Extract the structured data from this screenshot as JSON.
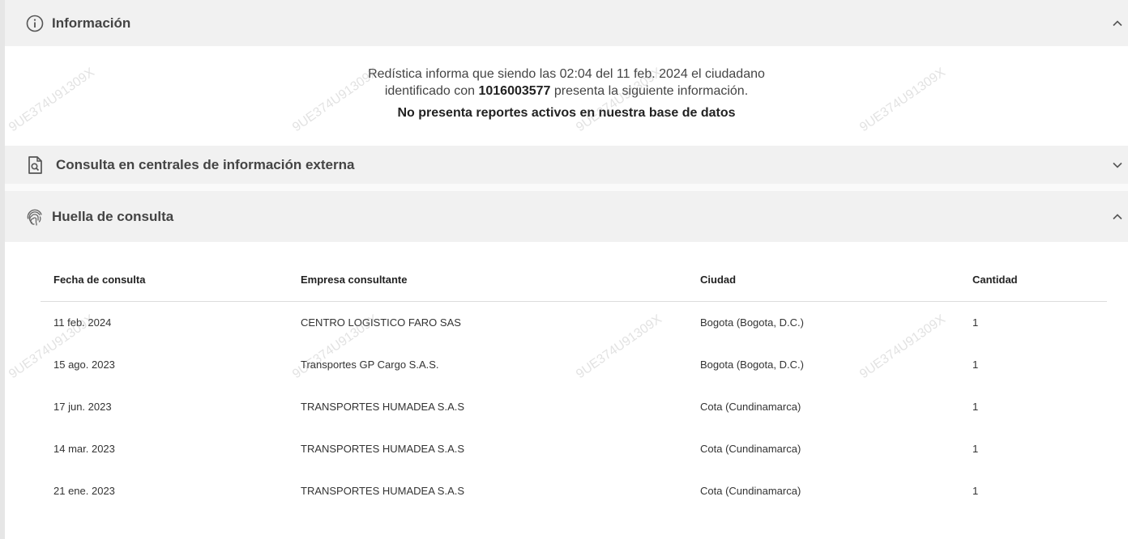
{
  "sections": {
    "informacion": {
      "title": "Información"
    },
    "externa": {
      "title": "Consulta en centrales de información externa"
    },
    "huella": {
      "title": "Huella de consulta"
    }
  },
  "info": {
    "line1": "Redística informa que siendo las 02:04 del 11 feb. 2024 el ciudadano",
    "line2_prefix": "identificado con ",
    "id_number": "1016003577",
    "line2_suffix": " presenta la siguiente información.",
    "no_reports": "No presenta reportes activos en nuestra base de datos"
  },
  "table": {
    "headers": [
      "Fecha de consulta",
      "Empresa consultante",
      "Ciudad",
      "Cantidad"
    ],
    "rows": [
      [
        "11 feb. 2024",
        "CENTRO LOGISTICO FARO SAS",
        "Bogota (Bogota, D.C.)",
        "1"
      ],
      [
        "15 ago. 2023",
        "Transportes GP Cargo S.A.S.",
        "Bogota (Bogota, D.C.)",
        "1"
      ],
      [
        "17 jun. 2023",
        "TRANSPORTES HUMADEA S.A.S",
        "Cota (Cundinamarca)",
        "1"
      ],
      [
        "14 mar. 2023",
        "TRANSPORTES HUMADEA S.A.S",
        "Cota (Cundinamarca)",
        "1"
      ],
      [
        "21 ene. 2023",
        "TRANSPORTES HUMADEA S.A.S",
        "Cota (Cundinamarca)",
        "1"
      ]
    ]
  },
  "watermark": "9UE374U91309X",
  "icons": {
    "info": "info-circle-icon",
    "externa": "document-search-icon",
    "huella": "fingerprint-icon",
    "collapse": "chevron-up-icon",
    "expand": "chevron-down-icon"
  },
  "colors": {
    "header_bg": "#f1f1f1",
    "text": "#444444",
    "watermark": "#969696"
  }
}
